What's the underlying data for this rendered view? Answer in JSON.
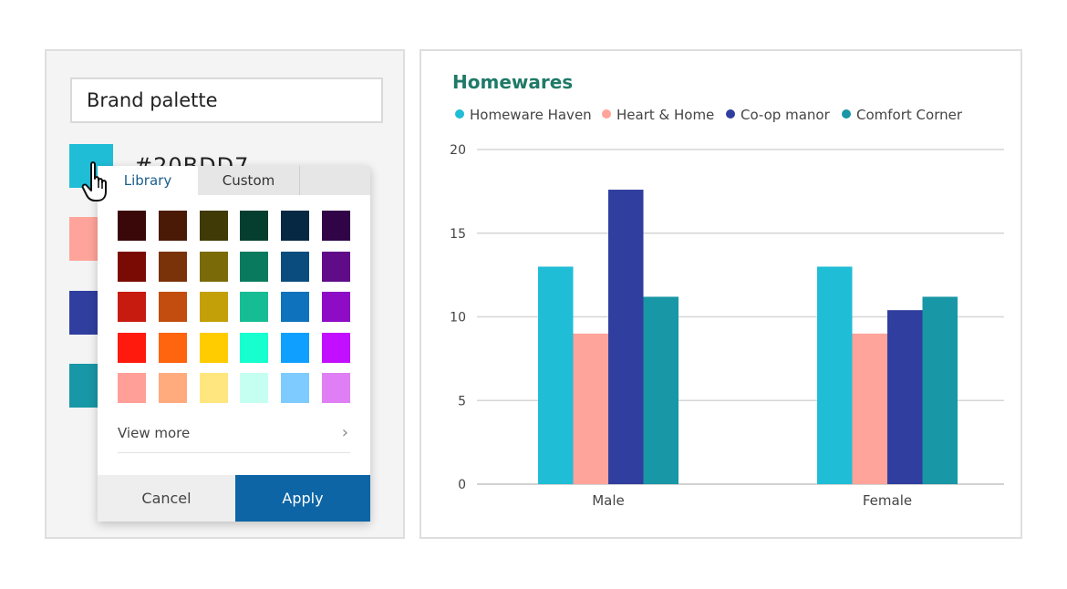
{
  "palette": {
    "name": "Brand palette",
    "swatches": [
      "#20BDD7",
      "#FFA49A",
      "#303E9F",
      "#1897A6"
    ],
    "selected_hex": "#20BDD7"
  },
  "picker": {
    "tabs": [
      "Library",
      "Custom"
    ],
    "active_tab": "Library",
    "colors": [
      [
        "#3a0808",
        "#4a1a07",
        "#3f3a06",
        "#053e2f",
        "#062843",
        "#300446"
      ],
      [
        "#7a0a04",
        "#7a3209",
        "#7a6a08",
        "#0a7a5e",
        "#0b4c7e",
        "#600b88"
      ],
      [
        "#c71b0f",
        "#c24d0f",
        "#c3a008",
        "#16bd94",
        "#0f72bc",
        "#8e0cc6"
      ],
      [
        "#ff1a0d",
        "#ff640f",
        "#ffcc00",
        "#17ffcf",
        "#0fa0ff",
        "#c20fff"
      ],
      [
        "#ff9f97",
        "#ffab7e",
        "#ffe67e",
        "#c5fff1",
        "#7ecbff",
        "#e07ef5"
      ]
    ],
    "view_more": "View more",
    "cancel_label": "Cancel",
    "apply_label": "Apply"
  },
  "colors": {
    "title": "#1f7a68",
    "apply": "#0d65a6",
    "grid": "#d6d6d6"
  },
  "chart_data": {
    "type": "bar",
    "title": "Homewares",
    "categories": [
      "Male",
      "Female"
    ],
    "series": [
      {
        "name": "Homeware Haven",
        "color": "#20BDD7",
        "values": [
          13,
          13
        ]
      },
      {
        "name": "Heart & Home",
        "color": "#FFA49A",
        "values": [
          9,
          9
        ]
      },
      {
        "name": "Co-op manor",
        "color": "#303E9F",
        "values": [
          17.6,
          10.4
        ]
      },
      {
        "name": "Comfort Corner",
        "color": "#1897A6",
        "values": [
          11.2,
          11.2
        ]
      }
    ],
    "ylim": [
      0,
      20
    ],
    "yticks": [
      0,
      5,
      10,
      15,
      20
    ],
    "grid": true,
    "legend": "top-left"
  }
}
